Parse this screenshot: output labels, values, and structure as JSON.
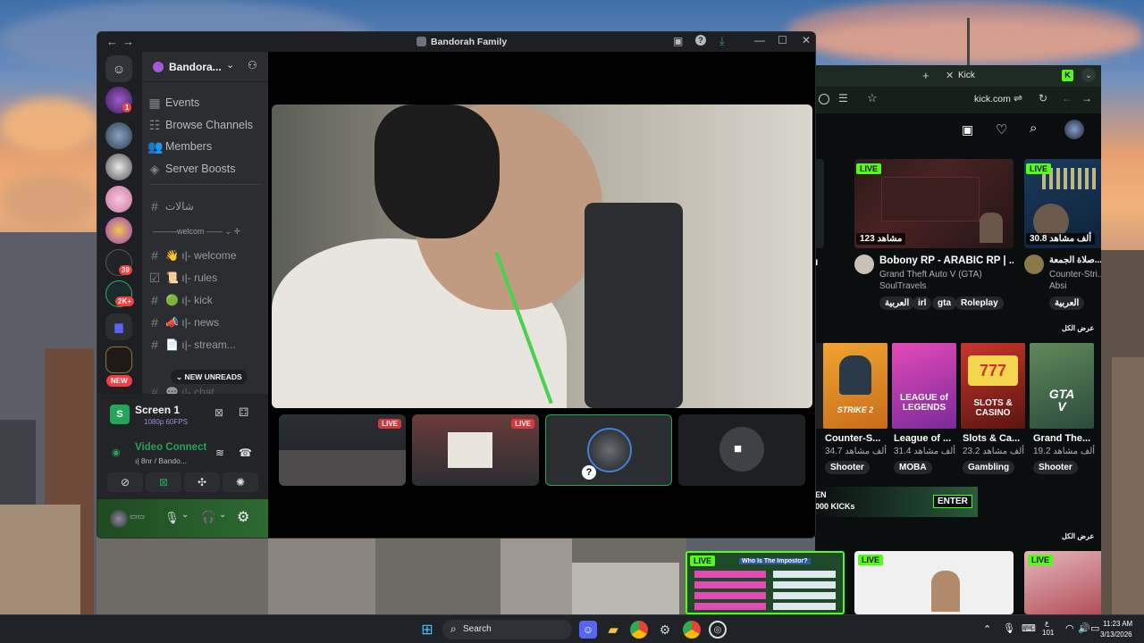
{
  "discord": {
    "window_title": "Bandorah Family",
    "server_name": "Bandora...",
    "menu": {
      "events": "Events",
      "browse_channels": "Browse Channels",
      "members": "Members",
      "server_boosts": "Server Boosts"
    },
    "pre_category_channel": "شالات",
    "category_welcome": "welcom",
    "channels": [
      {
        "name": "welcome",
        "icon": "👋",
        "prefix": "ı|‑ 🧡"
      },
      {
        "name": "rules",
        "icon": "📜",
        "prefix": "ı|‑"
      },
      {
        "name": "kick",
        "icon": "🟢",
        "prefix": "ı|‑"
      },
      {
        "name": "news",
        "icon": "📣",
        "prefix": "ı|‑"
      },
      {
        "name": "stream...",
        "icon": "📄",
        "prefix": "ı|‑"
      },
      {
        "name": "chat",
        "icon": "💬",
        "prefix": "ı|‑"
      }
    ],
    "new_unreads": "NEW UNREADS",
    "guild_badges": {
      "g1": "1",
      "g7": "39",
      "g8": "2K+",
      "new": "NEW"
    },
    "stream_panel": {
      "title": "Screen 1",
      "quality": "1080p 60FPS",
      "voice_status": "Video Connecte",
      "voice_sub": "ı| 8nr / Bando..."
    },
    "stage_tiles_live": "LIVE"
  },
  "kick": {
    "tab_title": "Kick",
    "url": "kick.com",
    "streams": [
      {
        "title": "Bobony RP - ARABIC RP | ...",
        "category": "Grand Theft Auto V (GTA)",
        "streamer": "SoulTravels",
        "viewers": "مشاهد 123",
        "tags": [
          "العربية",
          "irl",
          "gta",
          "Roleplay"
        ]
      },
      {
        "title": "صلاة الجمعة...",
        "category": "Counter-Stri...",
        "streamer": "Absi",
        "viewers": "30.8 ألف مشاهد",
        "tags": [
          "العربية"
        ]
      }
    ],
    "see_all": "عرض الكل",
    "live": "LIVE",
    "categories": [
      {
        "name": "Counter-S...",
        "viewers": "34.7 ألف مشاهد",
        "tag": "Shooter"
      },
      {
        "name": "League of ...",
        "viewers": "31.4 ألف مشاهد",
        "tag": "MOBA"
      },
      {
        "name": "Slots & Ca...",
        "viewers": "23.2 ألف مشاهد",
        "tag": "Gambling"
      },
      {
        "name": "Grand The...",
        "viewers": "19.2 ألف مشاهد",
        "tag": "Shooter"
      }
    ],
    "banner": {
      "line1": "EN",
      "line2": "000 KICKs",
      "cta": "ENTER"
    },
    "impostor_title": "Who Is The Impostor?"
  },
  "taskbar": {
    "search": "Search",
    "time": "11:23 AM",
    "date": "3/13/2026",
    "lang": "ع",
    "lang_num": "101"
  }
}
